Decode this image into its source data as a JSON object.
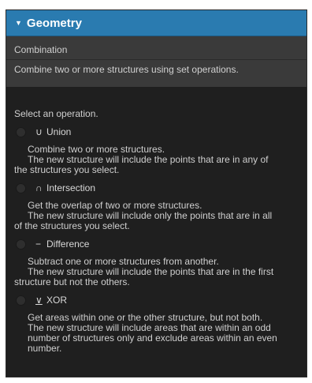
{
  "header": {
    "title": "Geometry",
    "collapse_icon": "triangle-down-icon"
  },
  "info": {
    "mode": "Combination",
    "summary": "Combine two or more structures using set operations."
  },
  "operations": {
    "prompt": "Select an operation.",
    "options": [
      {
        "symbol": "∪",
        "label": "Union",
        "desc_line1": "Combine two or more structures.",
        "desc_line2": "The new structure will include the points that are in any of",
        "desc_line3": "the structures you select.",
        "selected": false
      },
      {
        "symbol": "∩",
        "label": "Intersection",
        "desc_line1": "Get the overlap of two or more structures.",
        "desc_line2": "The new structure will include only the points that are in all",
        "desc_line3": "of the structures you select.",
        "selected": false
      },
      {
        "symbol": "−",
        "label": "Difference",
        "desc_line1": "Subtract one or more structures from another.",
        "desc_line2": "The new structure will include the points that are in the first",
        "desc_line3": "structure but not the others.",
        "selected": false
      },
      {
        "symbol": "∨",
        "label": "XOR",
        "desc_line1": "Get areas within one or the other structure, but not both.",
        "desc_line2": "The new structure will include areas that are within an odd",
        "desc_line3": "number of structures only and exclude areas within an even",
        "desc_line4": "number.",
        "selected": false
      }
    ]
  },
  "colors": {
    "header_bg": "#2a7bb0",
    "panel_bg": "#1f1f1f",
    "info_bg": "#3a3a3a",
    "text": "#d0d0d0"
  }
}
